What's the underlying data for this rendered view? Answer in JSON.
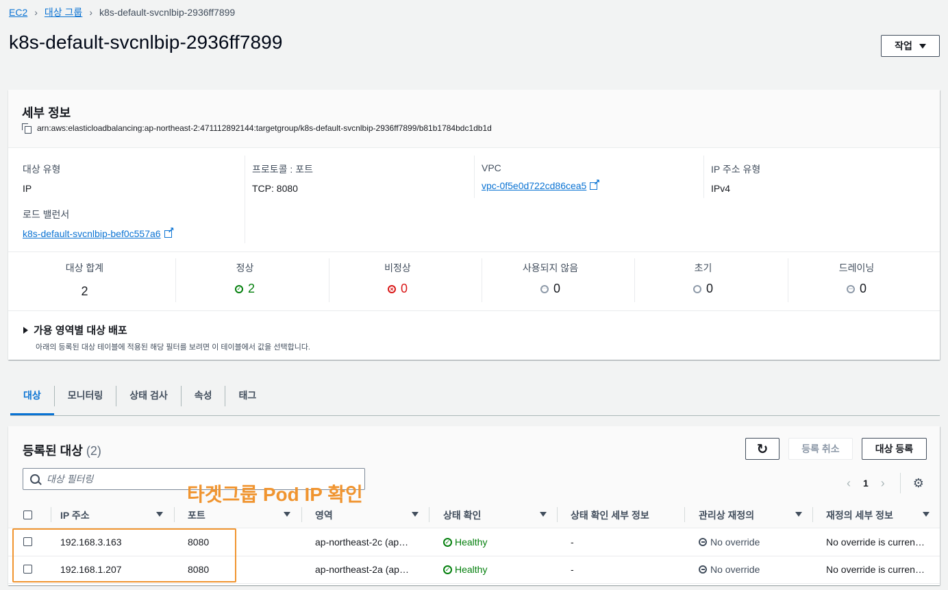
{
  "breadcrumb": {
    "root": "EC2",
    "parent": "대상 그룹",
    "current": "k8s-default-svcnlbip-2936ff7899"
  },
  "page_title": "k8s-default-svcnlbip-2936ff7899",
  "action_button": "작업",
  "details": {
    "title": "세부 정보",
    "arn": "arn:aws:elasticloadbalancing:ap-northeast-2:471112892144:targetgroup/k8s-default-svcnlbip-2936ff7899/b81b1784bdc1db1d",
    "target_type_label": "대상 유형",
    "target_type": "IP",
    "protocol_label": "프로토콜 : 포트",
    "protocol": "TCP: 8080",
    "vpc_label": "VPC",
    "vpc": "vpc-0f5e0d722cd86cea5",
    "ip_type_label": "IP 주소 유형",
    "ip_type": "IPv4",
    "lb_label": "로드 밸런서",
    "lb": "k8s-default-svcnlbip-bef0c557a6"
  },
  "stats": {
    "total_label": "대상 합계",
    "total": "2",
    "healthy_label": "정상",
    "healthy": "2",
    "unhealthy_label": "비정상",
    "unhealthy": "0",
    "unused_label": "사용되지 않음",
    "unused": "0",
    "initial_label": "초기",
    "initial": "0",
    "draining_label": "드레이닝",
    "draining": "0"
  },
  "az": {
    "title": "가용 영역별 대상 배포",
    "desc": "아래의 등록된 대상 테이블에 적용된 해당 필터를 보려면 이 테이블에서 값을 선택합니다."
  },
  "tabs": [
    "대상",
    "모니터링",
    "상태 검사",
    "속성",
    "태그"
  ],
  "targets": {
    "title": "등록된 대상",
    "count": "(2)",
    "deregister": "등록 취소",
    "register": "대상 등록",
    "filter_placeholder": "대상 필터링",
    "page": "1",
    "columns": [
      "IP 주소",
      "포트",
      "영역",
      "상태 확인",
      "상태 확인 세부 정보",
      "관리상 재정의",
      "재정의 세부 정보"
    ],
    "rows": [
      {
        "ip": "192.168.3.163",
        "port": "8080",
        "zone": "ap-northeast-2c (ap…",
        "health": "Healthy",
        "health_detail": "-",
        "override": "No override",
        "override_detail": "No override is curren…"
      },
      {
        "ip": "192.168.1.207",
        "port": "8080",
        "zone": "ap-northeast-2a (ap…",
        "health": "Healthy",
        "health_detail": "-",
        "override": "No override",
        "override_detail": "No override is curren…"
      }
    ]
  },
  "annotation": "타겟그룹 Pod IP 확인",
  "colors": {
    "link": "#0972d3",
    "healthy": "#037f0c",
    "unhealthy": "#d91515",
    "annotation": "#f0942f"
  }
}
